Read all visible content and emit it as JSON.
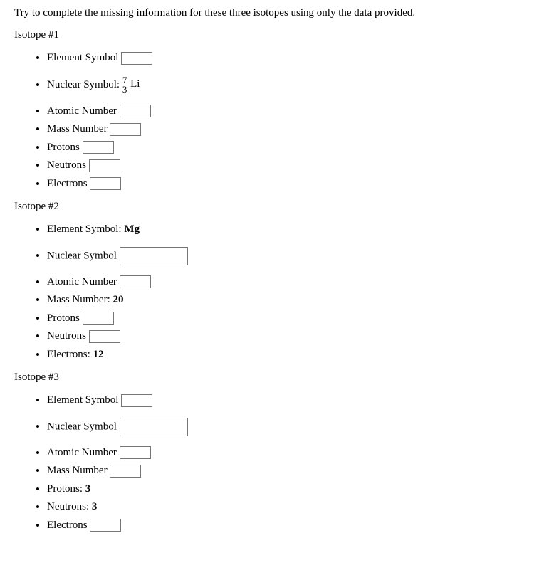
{
  "intro": "Try to complete the missing information for these three isotopes using only the data provided.",
  "labels": {
    "element_symbol": "Element Symbol",
    "nuclear_symbol": "Nuclear Symbol",
    "atomic_number": "Atomic Number",
    "mass_number": "Mass Number",
    "protons": "Protons",
    "neutrons": "Neutrons",
    "electrons": "Electrons"
  },
  "isotope1": {
    "title": "Isotope #1",
    "nuclear_top": "7",
    "nuclear_bot": "3",
    "nuclear_el": "Li"
  },
  "isotope2": {
    "title": "Isotope #2",
    "element_symbol_value": "Mg",
    "nuclear_symbol_colon": ":",
    "mass_number_value": "20",
    "electrons_value": "12"
  },
  "isotope3": {
    "title": "Isotope #3",
    "protons_value": "3",
    "neutrons_value": "3"
  }
}
